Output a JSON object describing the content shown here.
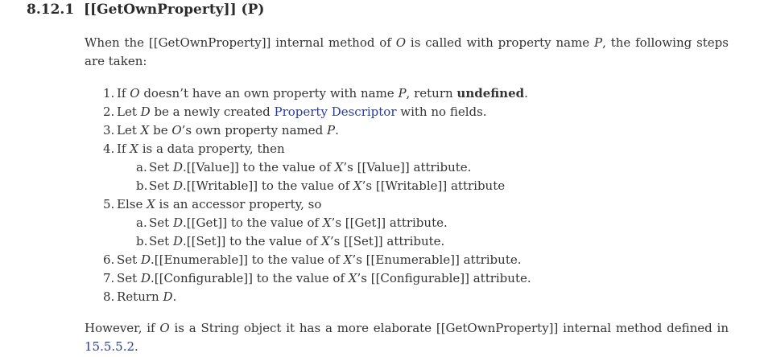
{
  "section": {
    "number": "8.12.1",
    "title": "[[GetOwnProperty]] (P)"
  },
  "intro": {
    "t1": "When the [[GetOwnProperty]] internal method of ",
    "o": "O",
    "t2": " is called with property name ",
    "p": "P",
    "t3": ", the following steps are taken:"
  },
  "steps": {
    "s1": {
      "marker": "1.",
      "t1": "If ",
      "o": "O",
      "t2": " doesn’t have an own property with name ",
      "p": "P",
      "t3": ", return ",
      "kw": "undefined",
      "t4": "."
    },
    "s2": {
      "marker": "2.",
      "t1": "Let ",
      "d": "D",
      "t2": " be a newly created ",
      "link": "Property Descriptor",
      "t3": " with no fields."
    },
    "s3": {
      "marker": "3.",
      "t1": "Let ",
      "x": "X",
      "t2": " be ",
      "o": "O",
      "t3": "’s own property named ",
      "p": "P",
      "t4": "."
    },
    "s4": {
      "marker": "4.",
      "t1": "If ",
      "x": "X",
      "t2": " is a data property, then"
    },
    "s4a": {
      "marker": "a.",
      "t1": "Set ",
      "d": "D",
      "t2": ".[[Value]] to the value of ",
      "x": "X",
      "t3": "’s [[Value]] attribute."
    },
    "s4b": {
      "marker": "b.",
      "t1": "Set ",
      "d": "D",
      "t2": ".[[Writable]] to the value of ",
      "x": "X",
      "t3": "’s [[Writable]] attribute"
    },
    "s5": {
      "marker": "5.",
      "t1": "Else ",
      "x": "X",
      "t2": " is an accessor property, so"
    },
    "s5a": {
      "marker": "a.",
      "t1": "Set ",
      "d": "D",
      "t2": ".[[Get]] to the value of ",
      "x": "X",
      "t3": "’s [[Get]] attribute."
    },
    "s5b": {
      "marker": "b.",
      "t1": "Set ",
      "d": "D",
      "t2": ".[[Set]] to the value of ",
      "x": "X",
      "t3": "’s [[Set]] attribute."
    },
    "s6": {
      "marker": "6.",
      "t1": "Set ",
      "d": "D",
      "t2": ".[[Enumerable]] to the value of ",
      "x": "X",
      "t3": "’s [[Enumerable]] attribute."
    },
    "s7": {
      "marker": "7.",
      "t1": "Set ",
      "d": "D",
      "t2": ".[[Configurable]] to the value of ",
      "x": "X",
      "t3": "’s [[Configurable]] attribute."
    },
    "s8": {
      "marker": "8.",
      "t1": "Return ",
      "d": "D",
      "t2": "."
    }
  },
  "closing": {
    "t1": "However, if ",
    "o": "O",
    "t2": " is a String object it has a more elaborate [[GetOwnProperty]] internal method defined in ",
    "link": "15.5.5.2",
    "t3": "."
  },
  "colors": {
    "link": "#2a3b9a",
    "text": "#333333"
  }
}
